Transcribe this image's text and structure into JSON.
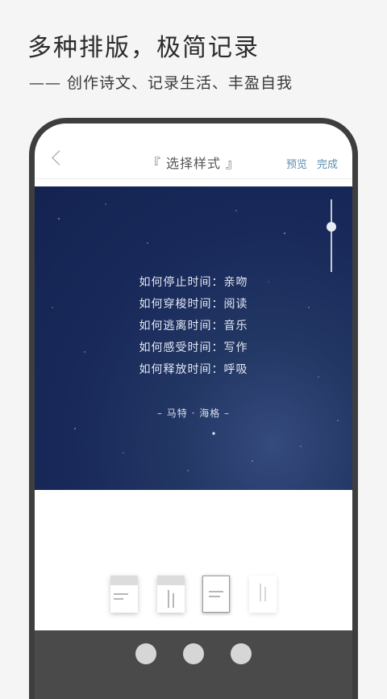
{
  "promo": {
    "headline": "多种排版，极简记录",
    "subline": "—— 创作诗文、记录生活、丰盈自我"
  },
  "nav": {
    "back_icon": "chevron-left-icon",
    "title": "『 选择样式 』",
    "preview_label": "预览",
    "done_label": "完成"
  },
  "card": {
    "background_color": "#18295a",
    "poem_lines": [
      "如何停止时间：亲吻",
      "如何穿梭时间：阅读",
      "如何逃离时间：音乐",
      "如何感受时间：写作",
      "如何释放时间：呼吸"
    ],
    "author": "– 马特 · 海格 –",
    "slider_icon": "vertical-slider"
  },
  "templates": {
    "items": [
      "header-band-left-lines",
      "header-band-vertical-lines",
      "centered-lines",
      "vertical-lines"
    ],
    "selected_index": 2
  },
  "colors": {
    "accent": "#5d8fb0",
    "frame": "#3e3e3e",
    "bottom_bar": "#4a4a4a"
  }
}
